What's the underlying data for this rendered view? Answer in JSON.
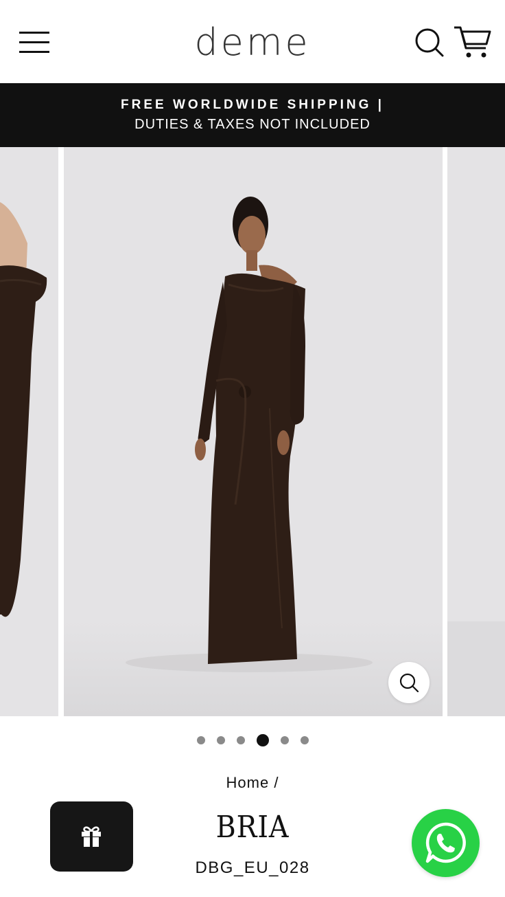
{
  "header": {
    "logo": "deme",
    "menu_icon": "hamburger-menu-icon",
    "search_icon": "search-icon",
    "cart_icon": "cart-icon"
  },
  "announcement": {
    "line1": "FREE WORLDWIDE SHIPPING |",
    "line2": "DUTIES & TAXES NOT INCLUDED"
  },
  "gallery": {
    "slide_count": 6,
    "active_index": 3,
    "zoom_icon": "zoom-icon",
    "background_color": "#e4e3e5",
    "dress_color": "#2e1e16"
  },
  "breadcrumb": {
    "home": "Home",
    "separator": "/"
  },
  "product": {
    "title": "BRIA",
    "sku": "DBG_EU_028"
  },
  "floating": {
    "gift_icon": "gift-icon",
    "whatsapp_icon": "whatsapp-icon",
    "whatsapp_color": "#28d146"
  }
}
